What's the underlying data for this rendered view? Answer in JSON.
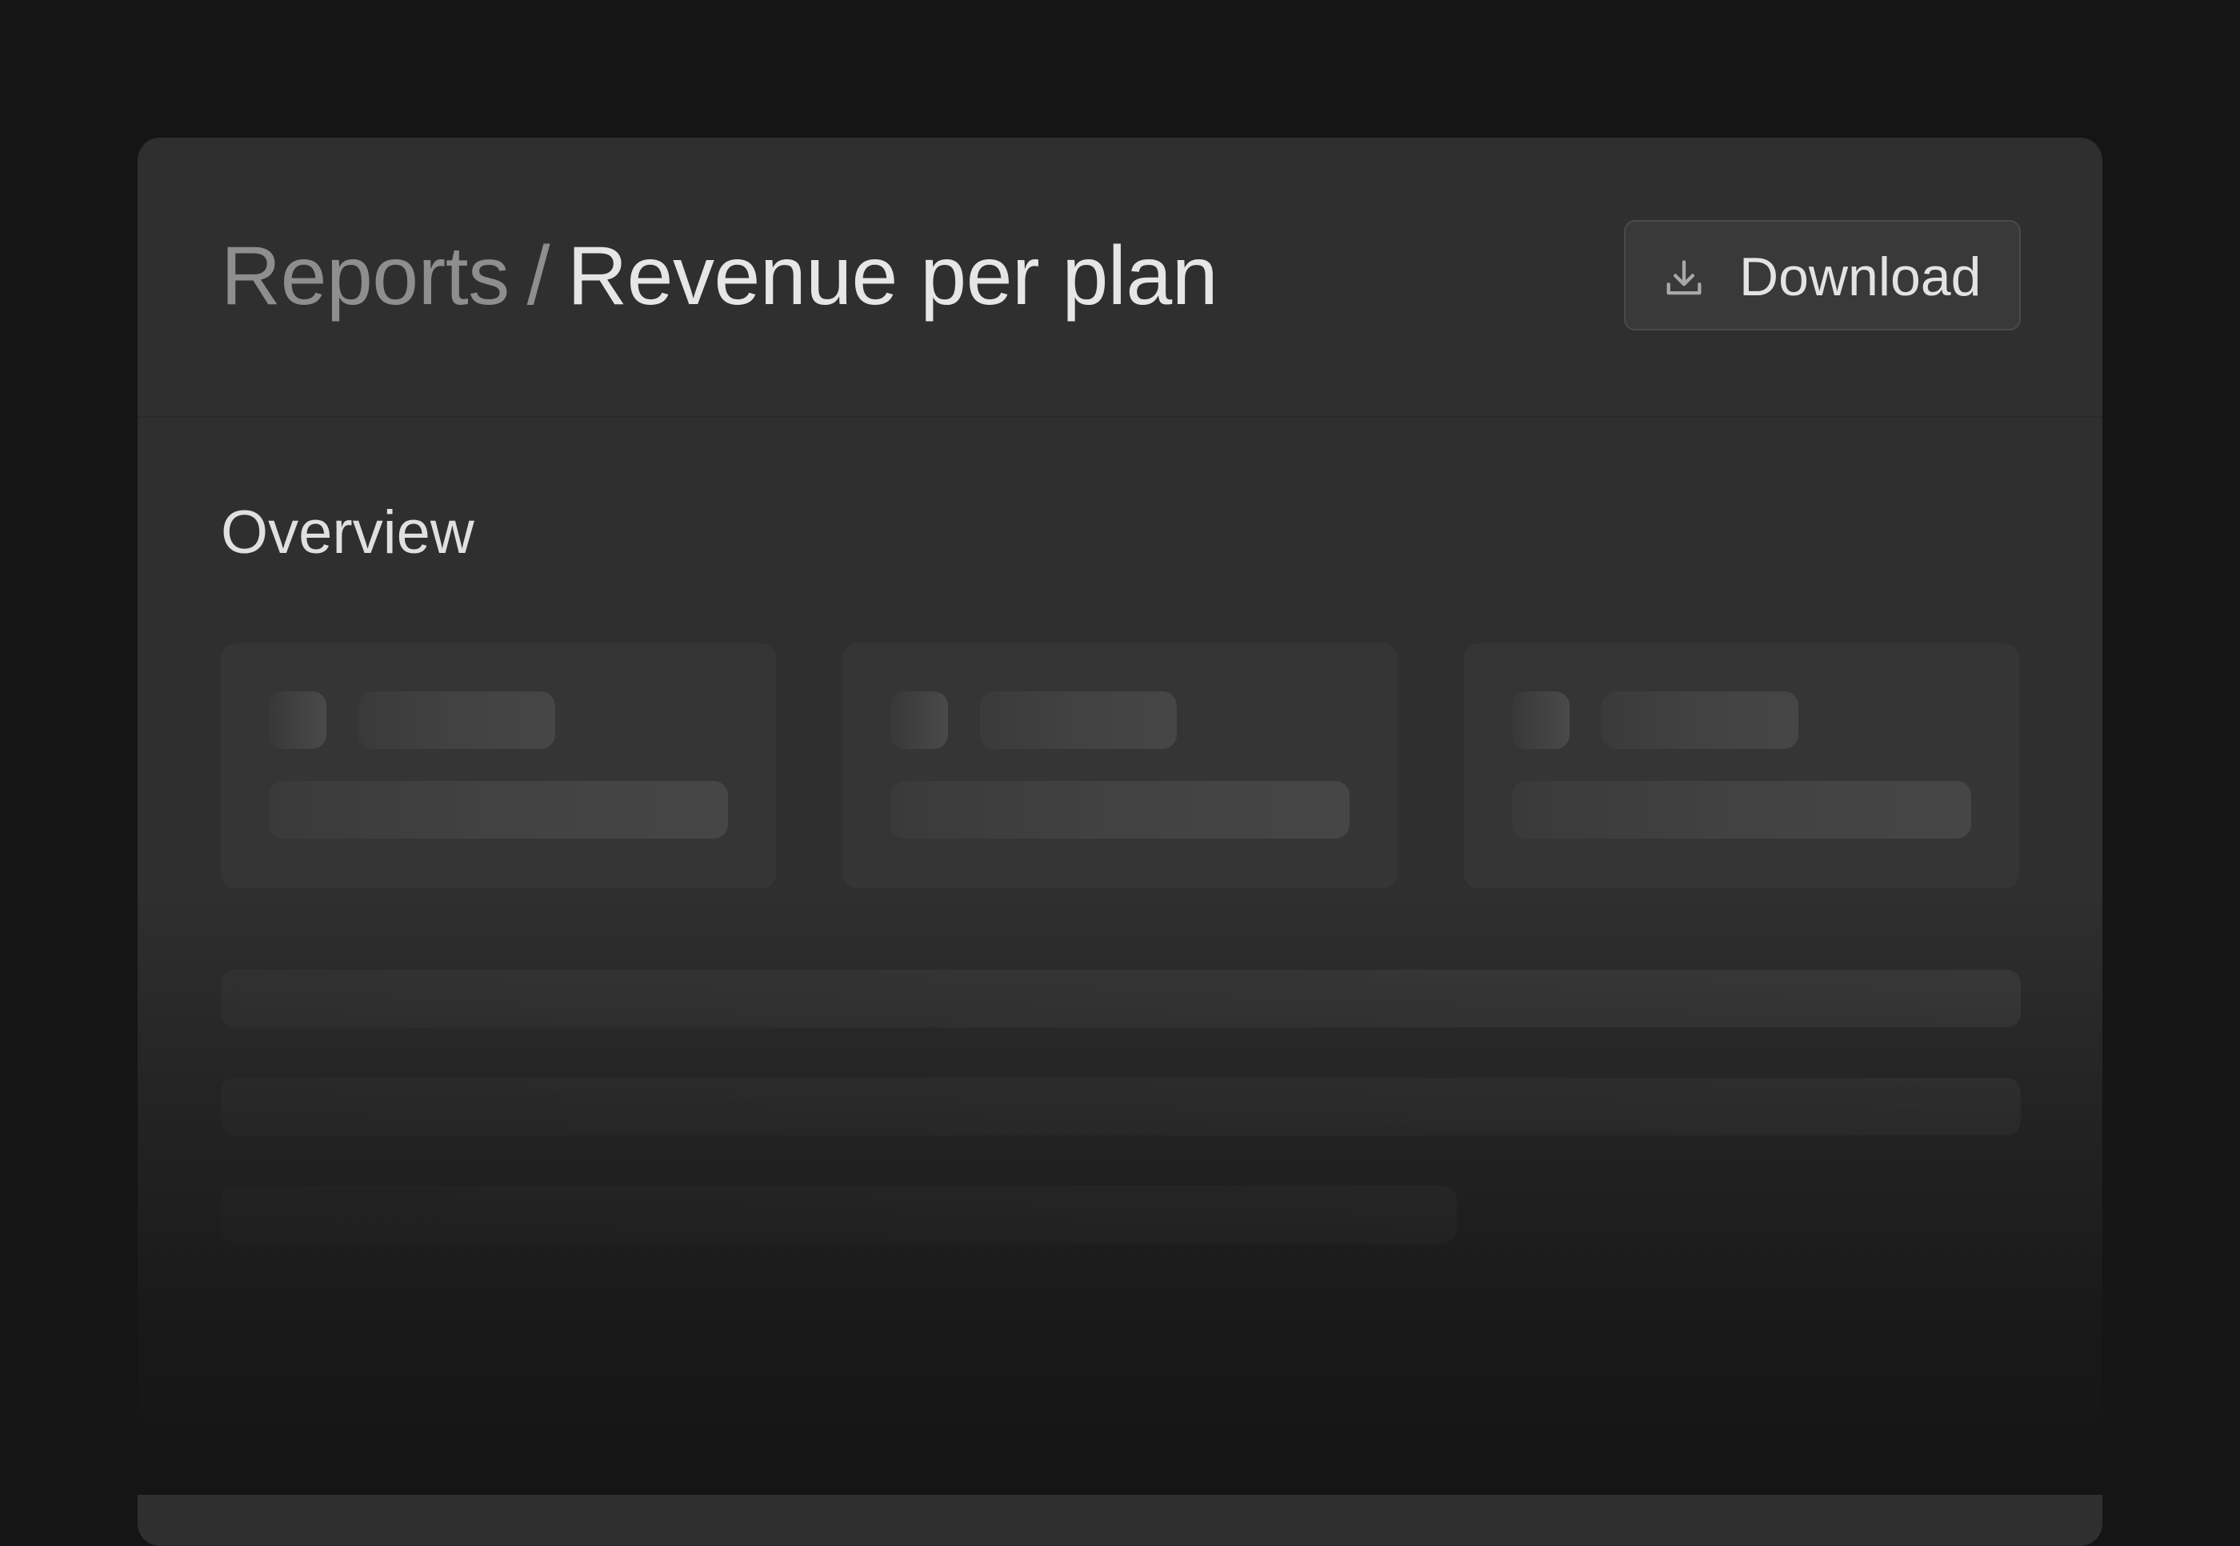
{
  "header": {
    "breadcrumb": {
      "parent": "Reports",
      "separator": "/",
      "current": "Revenue per plan"
    },
    "download_button": {
      "label": "Download",
      "icon": "download-icon"
    }
  },
  "main": {
    "section_title": "Overview"
  },
  "colors": {
    "background": "#151515",
    "panel": "#2f2f2f",
    "button": "#393939",
    "text_primary": "#e6e6e6",
    "text_muted": "#8e8e8e"
  }
}
